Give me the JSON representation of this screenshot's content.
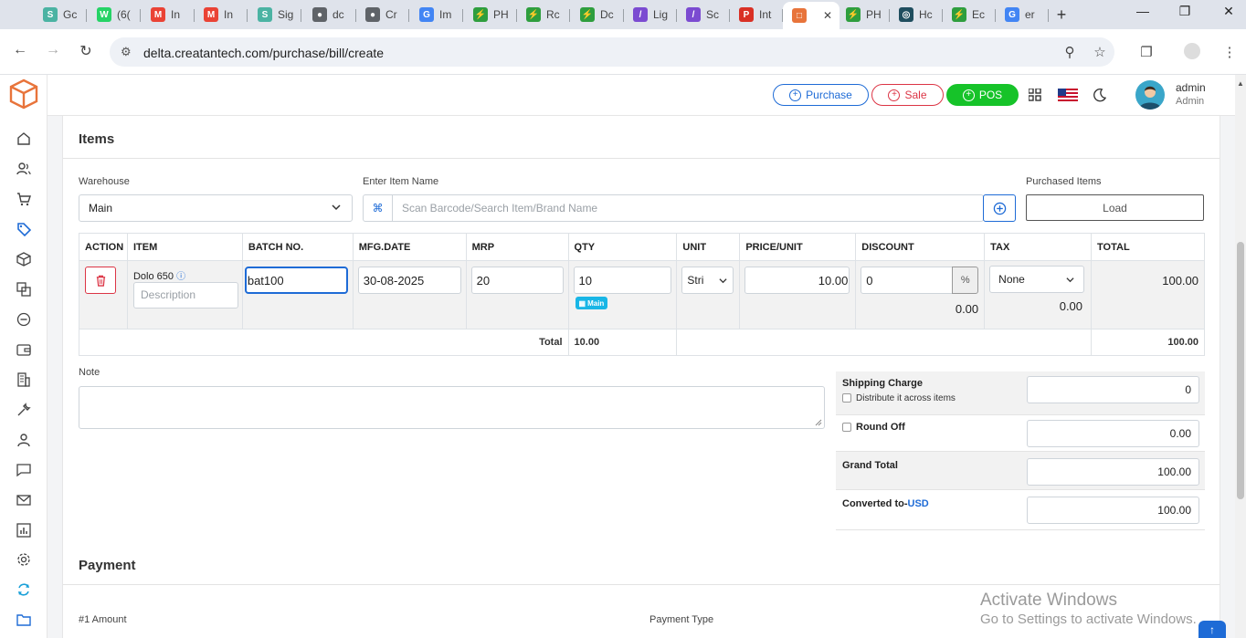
{
  "browser": {
    "tabs": [
      {
        "label": "Gc",
        "color": "#4bb3a3",
        "glyph": "S"
      },
      {
        "label": "(6(",
        "color": "#25d366",
        "glyph": "W"
      },
      {
        "label": "In",
        "color": "#ea4335",
        "glyph": "M"
      },
      {
        "label": "In",
        "color": "#ea4335",
        "glyph": "M"
      },
      {
        "label": "Sig",
        "color": "#4bb3a3",
        "glyph": "S"
      },
      {
        "label": "dc",
        "color": "#5f6368",
        "glyph": "●"
      },
      {
        "label": "Cr",
        "color": "#5f6368",
        "glyph": "●"
      },
      {
        "label": "Im",
        "color": "#4285f4",
        "glyph": "G"
      },
      {
        "label": "PH",
        "color": "#2e9e3e",
        "glyph": "⚡"
      },
      {
        "label": "Rc",
        "color": "#2e9e3e",
        "glyph": "⚡"
      },
      {
        "label": "Dc",
        "color": "#2e9e3e",
        "glyph": "⚡"
      },
      {
        "label": "Lig",
        "color": "#7b4bd1",
        "glyph": "/"
      },
      {
        "label": "Sc",
        "color": "#7b4bd1",
        "glyph": "/"
      },
      {
        "label": "Int",
        "color": "#d93025",
        "glyph": "P"
      },
      {
        "label": "",
        "color": "#e8743b",
        "glyph": "□"
      },
      {
        "label": "PH",
        "color": "#2e9e3e",
        "glyph": "⚡"
      },
      {
        "label": "Hc",
        "color": "#1f4e5f",
        "glyph": "◎"
      },
      {
        "label": "Ec",
        "color": "#2e9e3e",
        "glyph": "⚡"
      },
      {
        "label": "er",
        "color": "#4285f4",
        "glyph": "G"
      }
    ],
    "url": "delta.creatantech.com/purchase/bill/create"
  },
  "header": {
    "purchase_label": "Purchase",
    "sale_label": "Sale",
    "pos_label": "POS",
    "user_name": "admin",
    "user_role": "Admin"
  },
  "items_section": {
    "title": "Items",
    "warehouse_label": "Warehouse",
    "warehouse_value": "Main",
    "item_name_label": "Enter Item Name",
    "search_placeholder": "Scan Barcode/Search Item/Brand Name",
    "purchased_items_label": "Purchased Items",
    "load_label": "Load"
  },
  "table": {
    "headers": [
      "ACTION",
      "ITEM",
      "BATCH NO.",
      "MFG.DATE",
      "MRP",
      "QTY",
      "UNIT",
      "PRICE/UNIT",
      "DISCOUNT",
      "TAX",
      "TOTAL"
    ],
    "row": {
      "item_name": "Dolo 650",
      "description_placeholder": "Description",
      "batch_no": "bat100",
      "mfg_date": "30-08-2025",
      "mrp": "20",
      "qty": "10",
      "qty_badge": "Main",
      "unit": "Stri",
      "price": "10.00",
      "discount": "0",
      "discount_unit": "%",
      "discount_amount": "0.00",
      "tax": "None",
      "tax_amount": "0.00",
      "total": "100.00"
    },
    "total_row": {
      "label": "Total",
      "qty_total": "10.00",
      "amount_total": "100.00"
    }
  },
  "note_label": "Note",
  "summary": {
    "shipping_label": "Shipping Charge",
    "distribute_label": "Distribute it across items",
    "shipping_value": "0",
    "round_off_label": "Round Off",
    "round_off_value": "0.00",
    "grand_total_label": "Grand Total",
    "grand_total_value": "100.00",
    "converted_label": "Converted to-",
    "converted_currency": "USD",
    "converted_value": "100.00"
  },
  "payment": {
    "title": "Payment",
    "amount_label": "#1 Amount",
    "type_label": "Payment Type"
  },
  "watermark": {
    "line1": "Activate Windows",
    "line2": "Go to Settings to activate Windows."
  }
}
